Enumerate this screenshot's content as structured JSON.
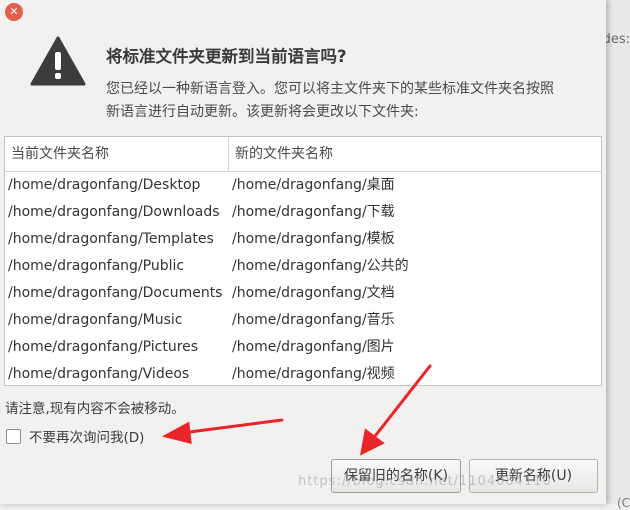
{
  "backdrop": {
    "text_right": "des:",
    "text_bottom": "(C"
  },
  "dialog": {
    "close_glyph": "✕",
    "title": "将标准文件夹更新到当前语言吗?",
    "description_line1": "您已经以一种新语言登入。您可以将主文件夹下的某些标准文件夹名按照",
    "description_line2": "新语言进行自动更新。该更新将会更改以下文件夹:",
    "table": {
      "columns": [
        "当前文件夹名称",
        "新的文件夹名称"
      ],
      "rows": [
        [
          "/home/dragonfang/Desktop",
          "/home/dragonfang/桌面"
        ],
        [
          "/home/dragonfang/Downloads",
          "/home/dragonfang/下载"
        ],
        [
          "/home/dragonfang/Templates",
          "/home/dragonfang/模板"
        ],
        [
          "/home/dragonfang/Public",
          "/home/dragonfang/公共的"
        ],
        [
          "/home/dragonfang/Documents",
          "/home/dragonfang/文档"
        ],
        [
          "/home/dragonfang/Music",
          "/home/dragonfang/音乐"
        ],
        [
          "/home/dragonfang/Pictures",
          "/home/dragonfang/图片"
        ],
        [
          "/home/dragonfang/Videos",
          "/home/dragonfang/视频"
        ]
      ]
    },
    "note": "请注意,现有内容不会被移动。",
    "dont_ask_label": "不要再次询问我(D)",
    "keep_button": "保留旧的名称(K)",
    "update_button": "更新名称(U)"
  },
  "watermark": "https://blog.csdn.net/1104084110",
  "colors": {
    "annotation_arrow": "#e8262a",
    "warning_icon": "#3c3c3c",
    "close_button": "#e0604c"
  }
}
